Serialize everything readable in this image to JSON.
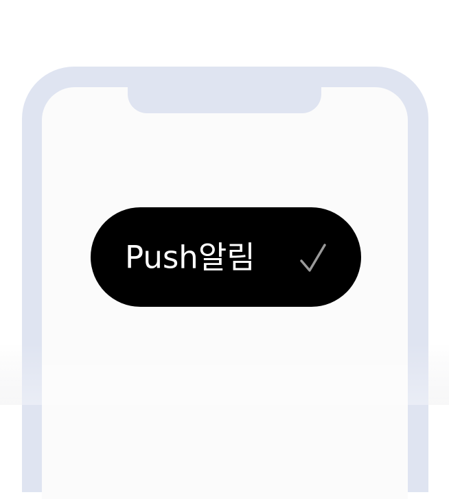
{
  "toggle": {
    "label": "Push알림",
    "checked": true,
    "check_icon": "check-icon"
  },
  "colors": {
    "phone_frame": "#dfe4f1",
    "screen": "#fbfbfb",
    "pill": "#000000",
    "label": "#ffffff",
    "check": "#9a9a9a"
  }
}
